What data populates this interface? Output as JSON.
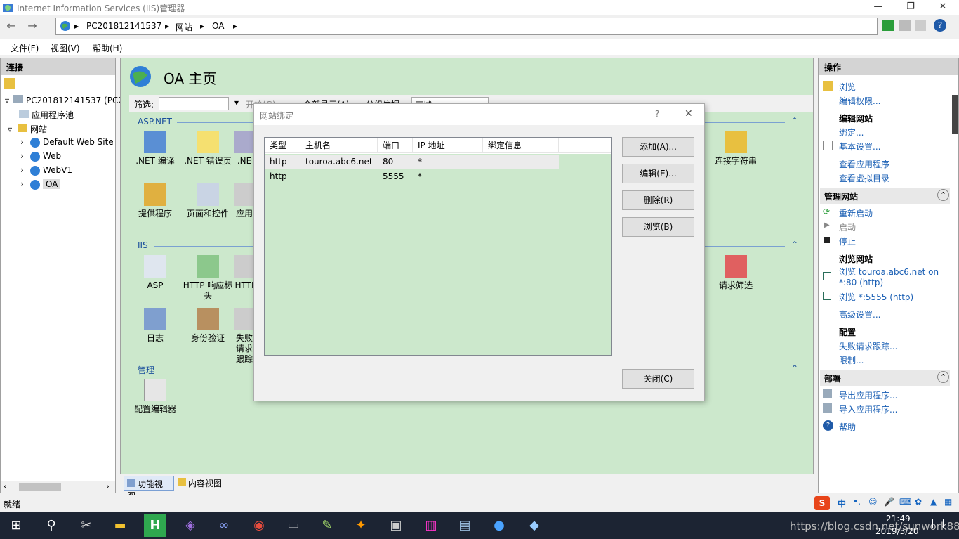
{
  "window": {
    "title": "Internet Information Services (IIS)管理器",
    "minimize": "—",
    "restore": "❐",
    "close": "✕"
  },
  "address": {
    "crumbs": [
      "PC201812141537",
      "网站",
      "OA"
    ],
    "sep": "▸"
  },
  "menu": [
    "文件(F)",
    "视图(V)",
    "帮助(H)"
  ],
  "left": {
    "title": "连接",
    "tree": [
      "PC201812141537 (PC20",
      "应用程序池",
      "网站",
      "Default Web Site",
      "Web",
      "WebV1",
      "OA"
    ]
  },
  "center": {
    "title": "OA 主页",
    "filter": {
      "label": "筛选:",
      "start": "开始(G)",
      "showall": "全部显示(A)",
      "groupby": "分组依据:",
      "groupval": "区域"
    },
    "sections": [
      "ASP.NET",
      "IIS",
      "管理"
    ],
    "aspnet": [
      ".NET 编译",
      ".NET 错误页",
      ".NE",
      "提供程序",
      "页面和控件",
      "应用",
      "连接字符串"
    ],
    "iis": [
      "ASP",
      "HTTP 响应标头",
      "HTTI",
      "日志",
      "身份验证",
      "失败请求跟踪",
      "请求筛选"
    ],
    "manage": [
      "配置编辑器"
    ]
  },
  "tabs": {
    "feature": "功能视图",
    "content": "内容视图"
  },
  "status": "就绪",
  "dialog": {
    "title": "网站绑定",
    "help": "?",
    "close": "✕",
    "columns": [
      "类型",
      "主机名",
      "端口",
      "IP 地址",
      "绑定信息"
    ],
    "rows": [
      [
        "http",
        "touroa.abc6.net",
        "80",
        "*",
        ""
      ],
      [
        "http",
        "",
        "5555",
        "*",
        ""
      ]
    ],
    "buttons": {
      "add": "添加(A)...",
      "edit": "编辑(E)...",
      "remove": "删除(R)",
      "browse": "浏览(B)",
      "closebtn": "关闭(C)"
    }
  },
  "right": {
    "title": "操作",
    "browse": "浏览",
    "editperm": "编辑权限...",
    "editsite": "编辑网站",
    "bind": "绑定...",
    "basic": "基本设置...",
    "viewapps": "查看应用程序",
    "viewvdir": "查看虚拟目录",
    "manage": "管理网站",
    "restart": "重新启动",
    "start": "启动",
    "stop": "停止",
    "browsesite": "浏览网站",
    "browse1a": "浏览 touroa.abc6.net on",
    "browse1b": "*:80 (http)",
    "browse2": "浏览 *:5555 (http)",
    "advanced": "高级设置...",
    "config": "配置",
    "failtrace": "失败请求跟踪...",
    "limit": "限制...",
    "deploy": "部署",
    "export": "导出应用程序...",
    "import": "导入应用程序...",
    "help": "帮助"
  },
  "tray": {
    "time": "21:49",
    "date": "2019/3/20",
    "ime": "中",
    "watermark": "https://blog.csdn.net/sunwork888"
  }
}
